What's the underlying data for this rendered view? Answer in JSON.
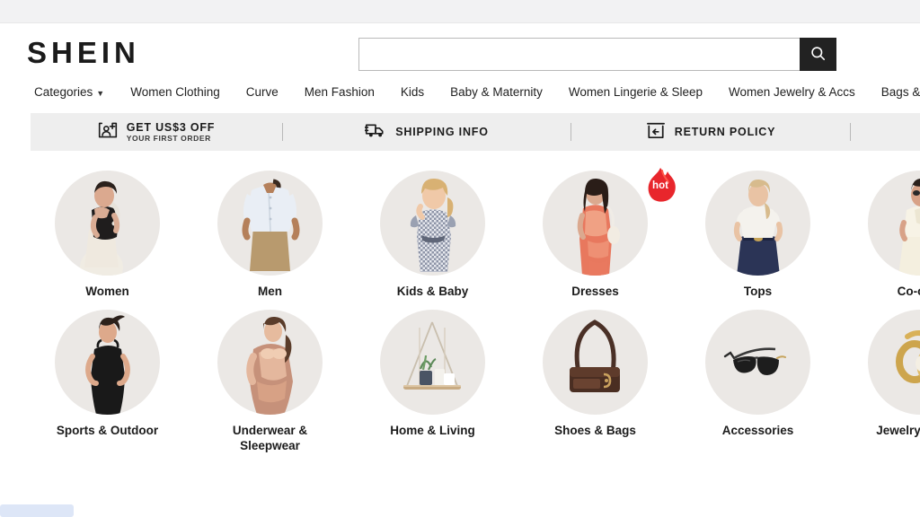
{
  "brand": {
    "name": "SHEIN",
    "accent": "#222222",
    "badge_color": "#e8262c"
  },
  "search": {
    "value": "",
    "placeholder": "",
    "button_icon": "search-icon"
  },
  "nav": {
    "items": [
      {
        "label": "Categories",
        "has_caret": true
      },
      {
        "label": "Women Clothing",
        "has_caret": false
      },
      {
        "label": "Curve",
        "has_caret": false
      },
      {
        "label": "Men Fashion",
        "has_caret": false
      },
      {
        "label": "Kids",
        "has_caret": false
      },
      {
        "label": "Baby & Maternity",
        "has_caret": false
      },
      {
        "label": "Women Lingerie & Sleep",
        "has_caret": false
      },
      {
        "label": "Women Jewelry & Accs",
        "has_caret": false
      },
      {
        "label": "Bags & Luggage",
        "has_caret": false
      }
    ]
  },
  "promo": {
    "items": [
      {
        "icon": "user-plus-card-icon",
        "title": "GET US$3 OFF",
        "subtitle": "YOUR FIRST ORDER"
      },
      {
        "icon": "delivery-truck-icon",
        "title": "SHIPPING INFO",
        "subtitle": ""
      },
      {
        "icon": "return-box-icon",
        "title": "RETURN POLICY",
        "subtitle": ""
      }
    ]
  },
  "categories": {
    "row1": [
      {
        "label": "Women",
        "art": "women",
        "badge": ""
      },
      {
        "label": "Men",
        "art": "men",
        "badge": ""
      },
      {
        "label": "Kids & Baby",
        "art": "kids",
        "badge": ""
      },
      {
        "label": "Dresses",
        "art": "dresses",
        "badge": "hot"
      },
      {
        "label": "Tops",
        "art": "tops",
        "badge": ""
      },
      {
        "label": "Co-ords",
        "art": "coords",
        "badge": ""
      }
    ],
    "row2": [
      {
        "label": "Sports & Outdoor",
        "art": "sports",
        "badge": ""
      },
      {
        "label": "Underwear &\nSleepwear",
        "art": "underwear",
        "badge": ""
      },
      {
        "label": "Home & Living",
        "art": "home",
        "badge": ""
      },
      {
        "label": "Shoes & Bags",
        "art": "shoes",
        "badge": ""
      },
      {
        "label": "Accessories",
        "art": "accessories",
        "badge": ""
      },
      {
        "label": "Jewelry & Accs",
        "art": "jewelry",
        "badge": ""
      }
    ]
  }
}
